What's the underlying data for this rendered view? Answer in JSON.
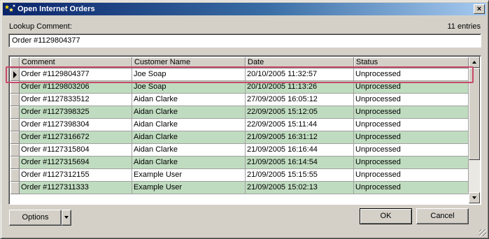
{
  "window": {
    "title": "Open Internet Orders",
    "app_icon": "stars-icon",
    "close_label": "×"
  },
  "lookup": {
    "label": "Lookup Comment:",
    "value": "Order #1129804377",
    "entries": "11 entries"
  },
  "grid": {
    "columns": [
      "Comment",
      "Customer Name",
      "Date",
      "Status"
    ],
    "rows": [
      {
        "comment": "Order #1129804377",
        "customer": "Joe Soap",
        "date": "20/10/2005 11:32:57",
        "status": "Unprocessed",
        "selected": true
      },
      {
        "comment": "Order #1129803206",
        "customer": "Joe Soap",
        "date": "20/10/2005 11:13:26",
        "status": "Unprocessed"
      },
      {
        "comment": "Order #1127833512",
        "customer": "Aidan Clarke",
        "date": "27/09/2005 16:05:12",
        "status": "Unprocessed"
      },
      {
        "comment": "Order #1127398325",
        "customer": "Aidan Clarke",
        "date": "22/09/2005 15:12:05",
        "status": "Unprocessed"
      },
      {
        "comment": "Order #1127398304",
        "customer": "Aidan Clarke",
        "date": "22/09/2005 15:11:44",
        "status": "Unprocessed"
      },
      {
        "comment": "Order #1127316672",
        "customer": "Aidan Clarke",
        "date": "21/09/2005 16:31:12",
        "status": "Unprocessed"
      },
      {
        "comment": "Order #1127315804",
        "customer": "Aidan Clarke",
        "date": "21/09/2005 16:16:44",
        "status": "Unprocessed"
      },
      {
        "comment": "Order #1127315694",
        "customer": "Aidan Clarke",
        "date": "21/09/2005 16:14:54",
        "status": "Unprocessed"
      },
      {
        "comment": "Order #1127312155",
        "customer": "Example User",
        "date": "21/09/2005 15:15:55",
        "status": "Unprocessed"
      },
      {
        "comment": "Order #1127311333",
        "customer": "Example User",
        "date": "21/09/2005 15:02:13",
        "status": "Unprocessed"
      }
    ],
    "row_alt_color": "#c0dcc0",
    "highlight_color": "#c84a68"
  },
  "buttons": {
    "options": "Options",
    "ok": "OK",
    "cancel": "Cancel"
  }
}
